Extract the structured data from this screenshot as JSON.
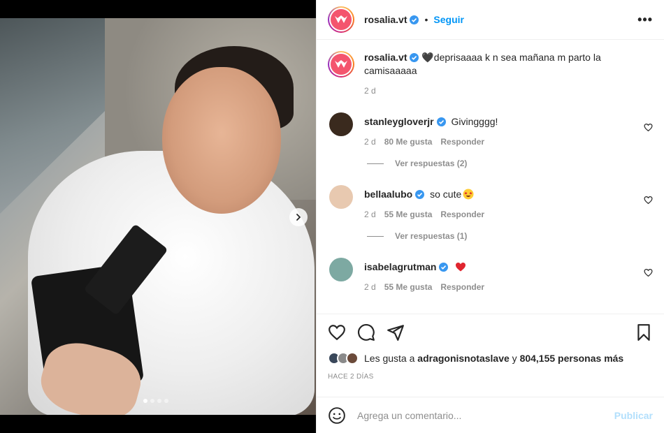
{
  "post": {
    "author": "rosalia.vt",
    "follow_label": "Seguir",
    "bullet": "•",
    "more_label": "•••",
    "caption_text": "🖤deprisaaaa k n sea mañana m parto la camisaaaaa",
    "caption_time": "2 d"
  },
  "carousel": {
    "total": 4,
    "active_index": 0
  },
  "comments": [
    {
      "user": "stanleygloverjr",
      "text": "Givingggg!",
      "emoji": "",
      "time": "2 d",
      "likes": "80 Me gusta",
      "reply_label": "Responder",
      "replies_label": "Ver respuestas (2)",
      "avatar_color": "#3a2a1e"
    },
    {
      "user": "bellaalubo",
      "text": "so cute",
      "emoji": "star-struck-emoji",
      "time": "2 d",
      "likes": "55 Me gusta",
      "reply_label": "Responder",
      "replies_label": "Ver respuestas (1)",
      "avatar_color": "#e8c9b0"
    },
    {
      "user": "isabelagrutman",
      "text": "",
      "emoji": "red-heart-emoji",
      "time": "2 d",
      "likes": "55 Me gusta",
      "reply_label": "Responder",
      "replies_label": "",
      "avatar_color": "#7da9a2"
    }
  ],
  "likes_line": {
    "prefix": "Les gusta a ",
    "user": "adragonisnotaslave",
    "middle": " y ",
    "count": "804,155 personas más"
  },
  "time_ago": "HACE 2 DÍAS",
  "composer": {
    "placeholder": "Agrega un comentario...",
    "publish_label": "Publicar"
  },
  "colors": {
    "accent": "#0095f6",
    "verified": "#3897f0",
    "publish_disabled": "#b2dffc",
    "brand_avatar": "#f4556e"
  },
  "icons": [
    "verified-badge-icon",
    "more-options-icon",
    "chevron-right-icon",
    "heart-outline-icon",
    "comment-icon",
    "share-icon",
    "bookmark-icon",
    "emoji-smile-icon"
  ]
}
